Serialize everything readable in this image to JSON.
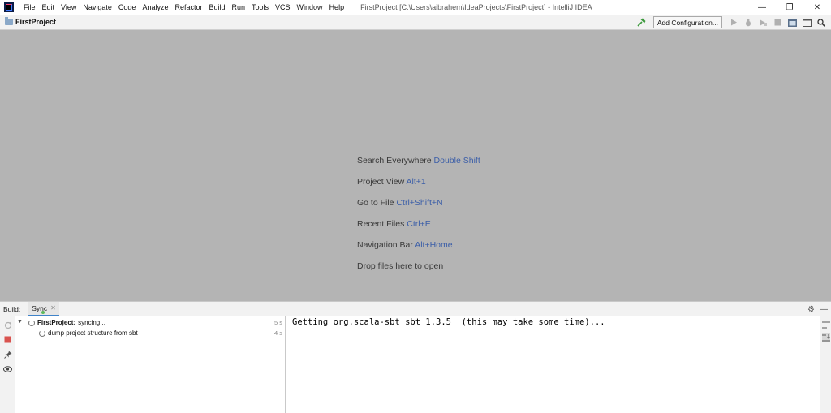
{
  "menu": {
    "items": [
      "File",
      "Edit",
      "View",
      "Navigate",
      "Code",
      "Analyze",
      "Refactor",
      "Build",
      "Run",
      "Tools",
      "VCS",
      "Window",
      "Help"
    ]
  },
  "window": {
    "title": "FirstProject [C:\\Users\\aibrahem\\IdeaProjects\\FirstProject] - IntelliJ IDEA",
    "minimize": "—",
    "restore": "❐",
    "close": "✕"
  },
  "navbar": {
    "project": "FirstProject",
    "add_configuration": "Add Configuration..."
  },
  "hints": [
    {
      "label": "Search Everywhere",
      "key": "Double Shift"
    },
    {
      "label": "Project View",
      "key": "Alt+1"
    },
    {
      "label": "Go to File",
      "key": "Ctrl+Shift+N"
    },
    {
      "label": "Recent Files",
      "key": "Ctrl+E"
    },
    {
      "label": "Navigation Bar",
      "key": "Alt+Home"
    },
    {
      "label": "Drop files here to open",
      "key": ""
    }
  ],
  "build": {
    "label": "Build:",
    "tab": "Sync",
    "tree": [
      {
        "name": "FirstProject:",
        "status": "syncing...",
        "time": "5 s"
      },
      {
        "name": "dump project structure from sbt",
        "status": "",
        "time": "4 s"
      }
    ],
    "console": "Getting org.scala-sbt sbt 1.3.5  (this may take some time)..."
  },
  "icons": {
    "hammer": "hammer-icon",
    "run": "run-icon",
    "debug": "debug-icon",
    "coverage": "coverage-icon",
    "stop": "stop-icon",
    "project-structure": "project-structure-icon",
    "frame": "frame-icon",
    "search": "search-icon",
    "settings": "gear-icon",
    "hide": "minimize-icon"
  },
  "colors": {
    "shortcut": "#3b5ea8",
    "editor_bg": "#b4b4b4",
    "stop": "#d9534f",
    "hammer": "#3d9a3d"
  }
}
